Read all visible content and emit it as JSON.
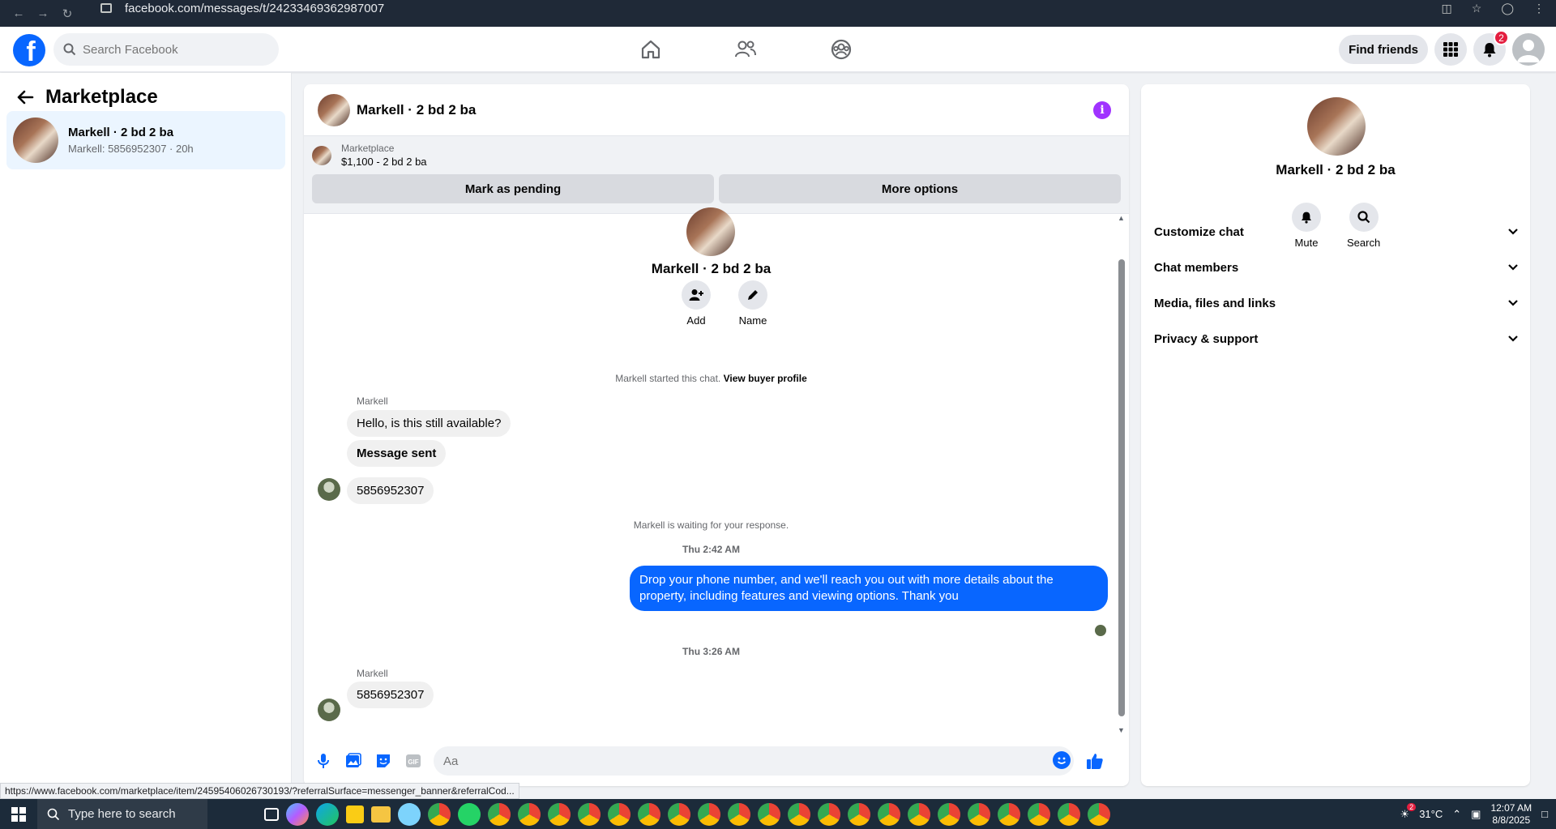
{
  "browser": {
    "url": "facebook.com/messages/t/24233469362987007"
  },
  "header": {
    "search_placeholder": "Search Facebook",
    "find_friends": "Find friends",
    "notification_count": "2"
  },
  "left": {
    "title": "Marketplace",
    "thread": {
      "name": "Markell · 2 bd 2 ba",
      "preview": "Markell: 5856952307 · 20h"
    }
  },
  "chat": {
    "title": "Markell · 2 bd 2 ba",
    "marketplace_label": "Marketplace",
    "listing": "$1,100 - 2 bd 2 ba",
    "mark_pending": "Mark as pending",
    "more_options": "More options",
    "center_name": "Markell · 2 bd 2 ba",
    "add_label": "Add",
    "name_label": "Name",
    "started_text": "Markell started this chat.",
    "view_buyer": "View buyer profile",
    "messages": [
      {
        "sender": "Markell",
        "text": "Hello, is this still available?"
      },
      {
        "text": "Message sent"
      },
      {
        "text": "5856952307"
      }
    ],
    "waiting": "Markell is waiting for your response.",
    "ts1": "Thu 2:42 AM",
    "outgoing": "Drop your phone number, and we'll reach you out with more details about the property, including features and viewing options.  Thank you",
    "ts2": "Thu 3:26 AM",
    "last_sender": "Markell",
    "last_msg": "5856952307",
    "composer_placeholder": "Aa"
  },
  "right": {
    "name": "Markell · 2 bd 2 ba",
    "mute": "Mute",
    "search": "Search",
    "sections": [
      "Customize chat",
      "Chat members",
      "Media, files and links",
      "Privacy & support"
    ]
  },
  "status_url": "https://www.facebook.com/marketplace/item/24595406026730193/?referralSurface=messenger_banner&referralCod...",
  "taskbar": {
    "search": "Type here to search",
    "temp": "31°C",
    "time": "12:07 AM",
    "date": "8/8/2025",
    "notif": "2"
  },
  "colors": {
    "fb_blue": "#0866ff",
    "selected_thread": "#ebf5ff",
    "info_purple": "#a033ff"
  }
}
